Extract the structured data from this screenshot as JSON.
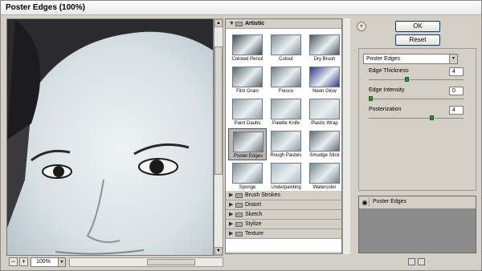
{
  "window": {
    "title": "Poster Edges (100%)"
  },
  "preview": {
    "zoom": "100%",
    "zoom_out": "−",
    "zoom_in": "+"
  },
  "gallery": {
    "open_category": "Artistic",
    "thumbnails": [
      "Colored Pencil",
      "Cutout",
      "Dry Brush",
      "Film Grain",
      "Fresco",
      "Neon Glow",
      "Paint Daubs",
      "Palette Knife",
      "Plastic Wrap",
      "Poster Edges",
      "Rough Pastels",
      "Smudge Stick",
      "Sponge",
      "Underpainting",
      "Watercolor"
    ],
    "selected_thumbnail": "Poster Edges",
    "categories": [
      "Brush Strokes",
      "Distort",
      "Sketch",
      "Stylize",
      "Texture"
    ]
  },
  "buttons": {
    "ok": "OK",
    "reset": "Reset",
    "collapse": "«"
  },
  "settings": {
    "filter": "Poster Edges",
    "params": [
      {
        "label": "Edge Thickness",
        "value": "4",
        "slider_fraction": 0.4
      },
      {
        "label": "Edge Intensity",
        "value": "0",
        "slider_fraction": 0.0
      },
      {
        "label": "Posterization",
        "value": "4",
        "slider_fraction": 0.67
      }
    ]
  },
  "layers": {
    "effect_name": "Poster Edges"
  },
  "colors": {
    "accent": "#2e8b3a",
    "selected_thumb": "#b8b8b8"
  }
}
